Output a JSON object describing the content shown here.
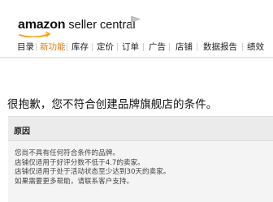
{
  "header": {
    "logo_amazon": "amazon",
    "logo_seller_central": "seller central"
  },
  "nav": {
    "items": [
      {
        "label": "目录",
        "active": false
      },
      {
        "label": "新功能",
        "active": true
      },
      {
        "label": "库存",
        "active": false
      },
      {
        "label": "定价",
        "active": false
      },
      {
        "label": "订单",
        "active": false
      },
      {
        "label": "广告",
        "active": false
      },
      {
        "label": "店铺",
        "active": false
      },
      {
        "label": "数据报告",
        "active": false
      },
      {
        "label": "绩效",
        "active": false
      }
    ]
  },
  "main": {
    "title": "很抱歉，您不符合创建品牌旗舰店的条件。",
    "panel_header": "原因",
    "reasons": [
      "您尚不具有任何符合条件的品牌。",
      "店铺仅适用于好评分数不低于4.7的卖家。",
      "店铺仅适用于处于活动状态至少达到30天的卖家。",
      "如果需要更多帮助，请联系客户支持。"
    ]
  },
  "colors": {
    "accent": "#e47911",
    "logo_smile": "#ff9900"
  }
}
